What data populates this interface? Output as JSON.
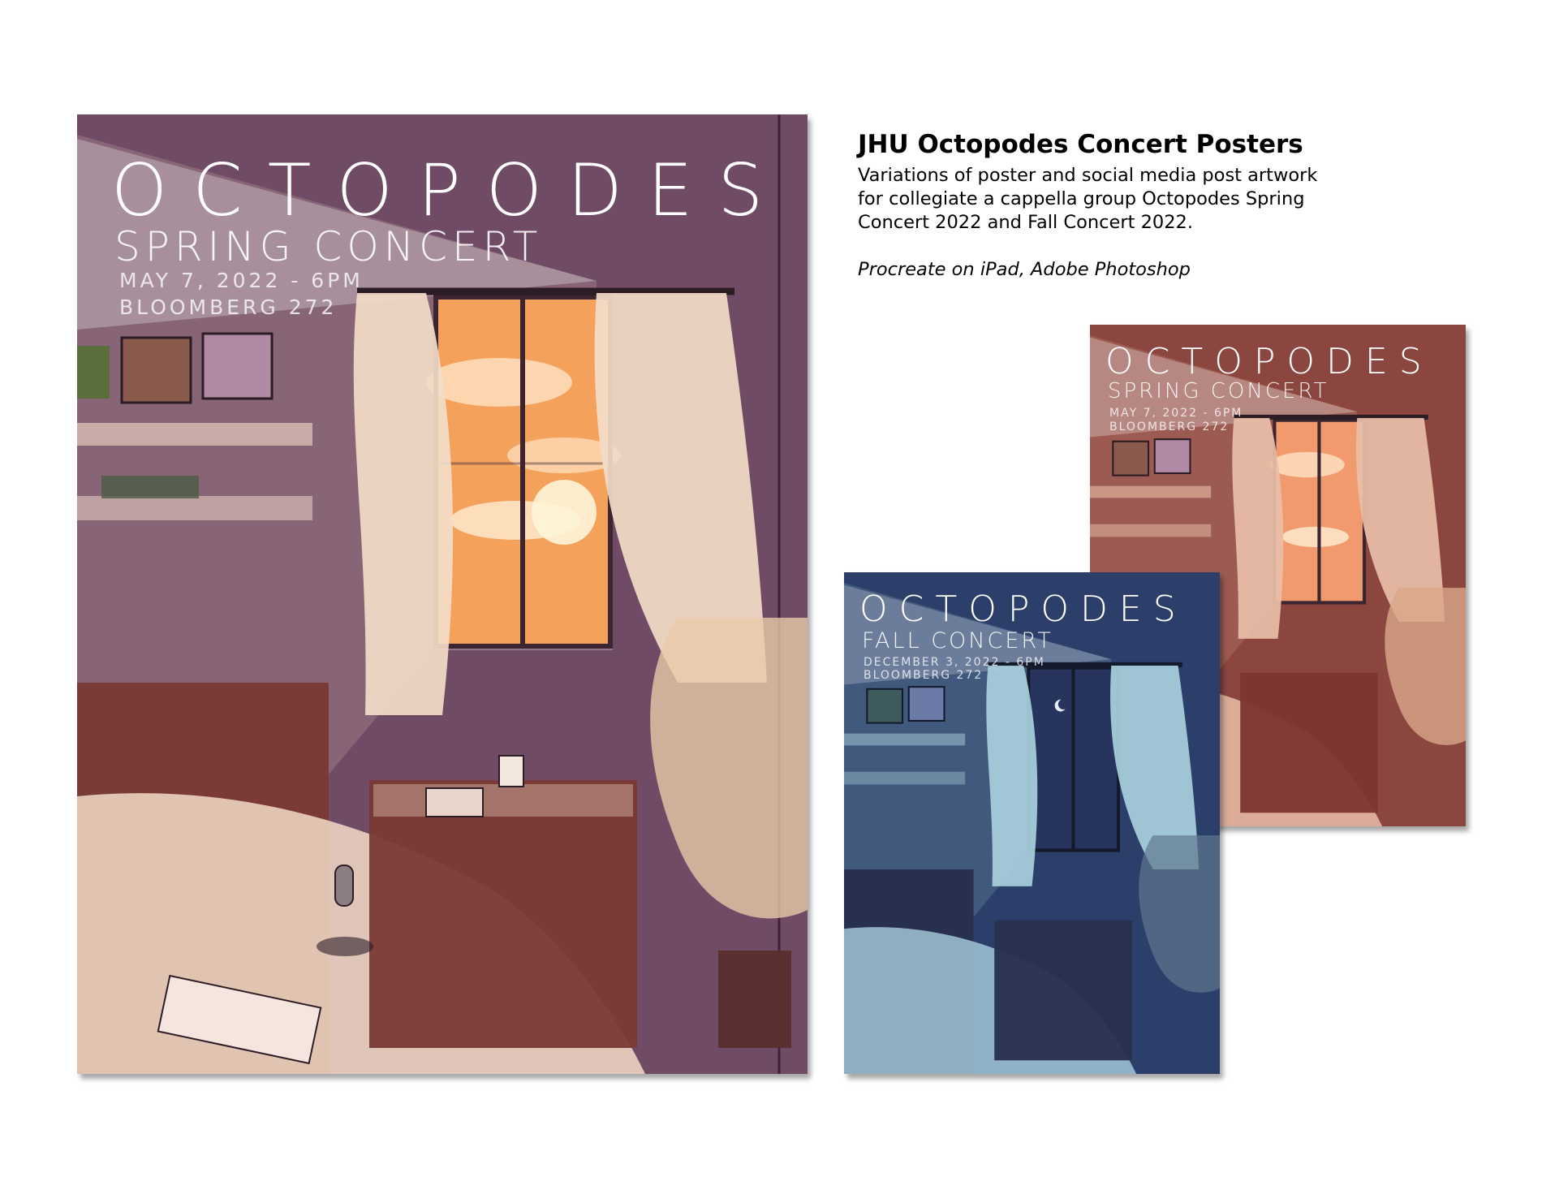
{
  "info": {
    "title": "JHU Octopodes Concert Posters",
    "description": "Variations of poster and social media post artwork for collegiate a cappella group Octopodes Spring Concert 2022 and Fall Concert 2022.",
    "tools": "Procreate on iPad, Adobe Photoshop"
  },
  "posters": {
    "main": {
      "title": "OCTOPODES",
      "subtitle": "SPRING CONCERT",
      "date": "MAY 7, 2022 - 6PM",
      "location": "BLOOMBERG 272",
      "palette": {
        "wall": "#6f4b66",
        "light": "#f3dcc8",
        "sky": "#f4a15c",
        "furniture": "#7a3a36"
      }
    },
    "spring_small": {
      "title": "OCTOPODES",
      "subtitle": "SPRING CONCERT",
      "date": "MAY 7, 2022 - 6PM",
      "location": "BLOOMBERG 272",
      "palette": {
        "wall": "#8b4640",
        "light": "#e9bfa8",
        "sky": "#f19a6e",
        "furniture": "#7e3530"
      }
    },
    "fall": {
      "title": "OCTOPODES",
      "subtitle": "FALL CONCERT",
      "date": "DECEMBER 3, 2022 - 6PM",
      "location": "BLOOMBERG 272",
      "palette": {
        "wall": "#2c3f6a",
        "light": "#a9d0dd",
        "sky": "#27355e",
        "furniture": "#28304f"
      }
    }
  }
}
